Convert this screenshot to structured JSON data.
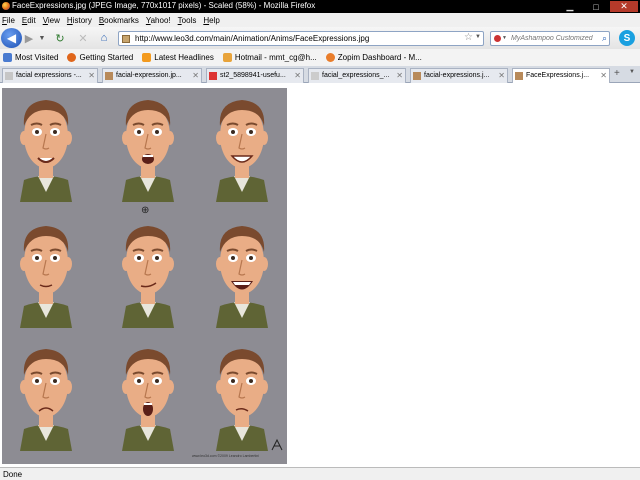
{
  "window": {
    "title": "FaceExpressions.jpg (JPEG Image, 770x1017 pixels) - Scaled (58%) - Mozilla Firefox"
  },
  "menu": [
    "File",
    "Edit",
    "View",
    "History",
    "Bookmarks",
    "Yahoo!",
    "Tools",
    "Help"
  ],
  "nav": {
    "url": "http://www.leo3d.com/main/Animation/Anims/FaceExpressions.jpg",
    "search_placeholder": "MyAshampoo Customized"
  },
  "bookmarks": [
    {
      "label": "Most Visited",
      "icon": "gear-icon",
      "color": "#4a7bd0"
    },
    {
      "label": "Getting Started",
      "icon": "firefox-icon",
      "color": "#e0661b"
    },
    {
      "label": "Latest Headlines",
      "icon": "rss-icon",
      "color": "#f39a1e"
    },
    {
      "label": "Hotmail - mmt_cg@h...",
      "icon": "hotmail-icon",
      "color": "#e8a33a"
    },
    {
      "label": "Zopim Dashboard - M...",
      "icon": "zopim-icon",
      "color": "#e97d2b"
    }
  ],
  "tabs": [
    {
      "label": "facial expressions -...",
      "active": false,
      "favicon_color": "#c6c6c6"
    },
    {
      "label": "facial-expression.jp...",
      "active": false,
      "favicon_color": "#b88a5a"
    },
    {
      "label": "st2_5898941-usefu...",
      "active": false,
      "favicon_color": "#d33"
    },
    {
      "label": "facial_expressions_...",
      "active": false,
      "favicon_color": "#ccc"
    },
    {
      "label": "facial-expressions.j...",
      "active": false,
      "favicon_color": "#b88a5a"
    },
    {
      "label": "FaceExpressions.j...",
      "active": true,
      "favicon_color": "#b88a5a"
    }
  ],
  "image": {
    "faces": [
      {
        "expression": "smile"
      },
      {
        "expression": "open"
      },
      {
        "expression": "grin"
      },
      {
        "expression": "content"
      },
      {
        "expression": "sly"
      },
      {
        "expression": "laugh"
      },
      {
        "expression": "sad"
      },
      {
        "expression": "shock"
      },
      {
        "expression": "worried"
      }
    ],
    "footnote": "www.leo3d.com  ©2009 Leandro Lambertini"
  },
  "status": {
    "text": "Done"
  },
  "colors": {
    "image_bg": "#8d8c93",
    "skin": "#e9ad86",
    "hair": "#7a4a2e",
    "vest": "#5f6435",
    "shirt": "#e8e6dc"
  }
}
